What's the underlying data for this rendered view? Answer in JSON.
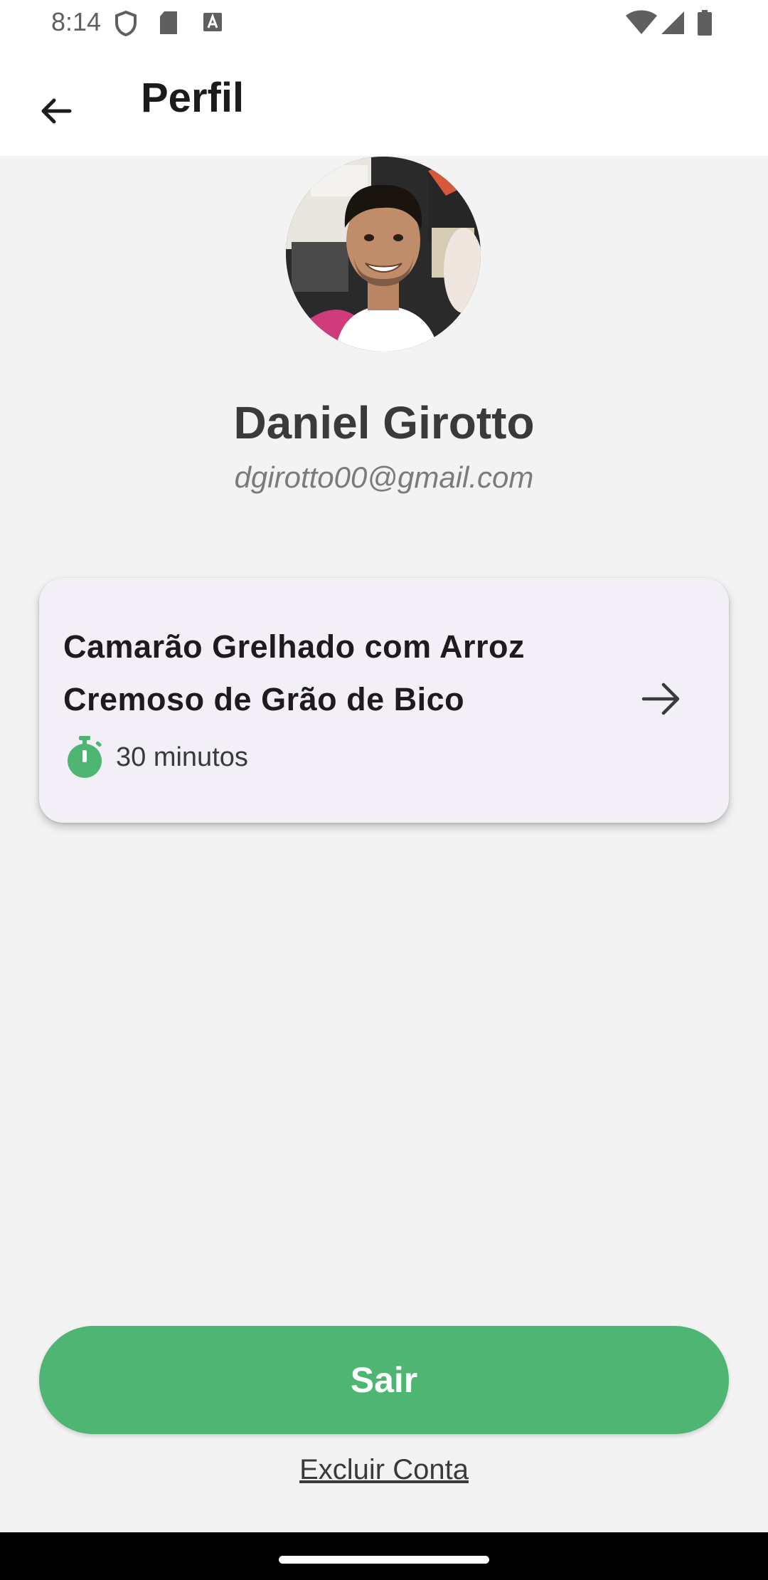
{
  "status_bar": {
    "time": "8:14"
  },
  "app_bar": {
    "title": "Perfil",
    "back_icon": "arrow-back-icon"
  },
  "profile": {
    "name": "Daniel Girotto",
    "email": "dgirotto00@gmail.com",
    "avatar_icon": "profile-photo"
  },
  "recipe_card": {
    "title": "Camarão Grelhado com Arroz Cremoso de Grão de Bico",
    "time": "30 minutos",
    "timer_icon": "timer-icon",
    "arrow_icon": "arrow-forward-icon"
  },
  "actions": {
    "logout_label": "Sair",
    "delete_account_label": "Excluir Conta"
  },
  "colors": {
    "accent_green": "#4fb573",
    "card_background": "#f3eff6",
    "page_background": "#f3f3f4"
  }
}
